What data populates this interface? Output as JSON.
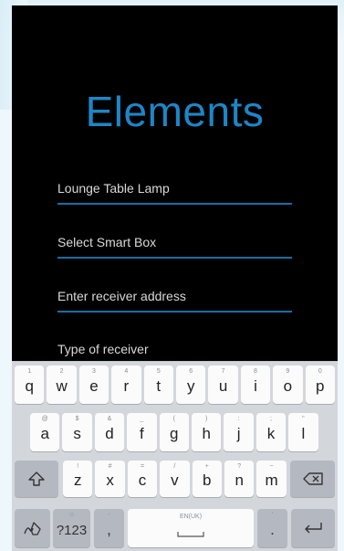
{
  "app": {
    "title": "Elements",
    "fields": [
      {
        "value": "Lounge Table Lamp",
        "placeholder": ""
      },
      {
        "value": "",
        "placeholder": "Select Smart Box"
      },
      {
        "value": "",
        "placeholder": "Enter receiver address"
      },
      {
        "value": "",
        "placeholder": "Type of receiver"
      }
    ]
  },
  "keyboard": {
    "row1": [
      {
        "label": "q",
        "hint": "1"
      },
      {
        "label": "w",
        "hint": "2"
      },
      {
        "label": "e",
        "hint": "3"
      },
      {
        "label": "r",
        "hint": "4"
      },
      {
        "label": "t",
        "hint": "5"
      },
      {
        "label": "y",
        "hint": "6"
      },
      {
        "label": "u",
        "hint": "7"
      },
      {
        "label": "i",
        "hint": "8"
      },
      {
        "label": "o",
        "hint": "9"
      },
      {
        "label": "p",
        "hint": "0"
      }
    ],
    "row2": [
      {
        "label": "a",
        "hint": "@"
      },
      {
        "label": "s",
        "hint": "$"
      },
      {
        "label": "d",
        "hint": "&"
      },
      {
        "label": "f",
        "hint": "_"
      },
      {
        "label": "g",
        "hint": "("
      },
      {
        "label": "h",
        "hint": ")"
      },
      {
        "label": "j",
        "hint": ":"
      },
      {
        "label": "k",
        "hint": ";"
      },
      {
        "label": "l",
        "hint": "\""
      }
    ],
    "row3": [
      {
        "label": "z",
        "hint": "!"
      },
      {
        "label": "x",
        "hint": "#"
      },
      {
        "label": "c",
        "hint": "="
      },
      {
        "label": "v",
        "hint": "/"
      },
      {
        "label": "b",
        "hint": "+"
      },
      {
        "label": "n",
        "hint": "?"
      },
      {
        "label": "m",
        "hint": "~"
      }
    ],
    "shift_icon": "shift-arrow-icon",
    "backspace_icon": "backspace-icon",
    "handwriting_icon": "handwriting-icon",
    "symbols_label": "?123",
    "symbols_hint": "☺",
    "comma_label": ",",
    "comma_hint": "-",
    "space_hint": "EN(UK)",
    "period_label": ".",
    "period_hint": "'",
    "enter_icon": "enter-icon"
  },
  "colors": {
    "accent": "#1d86c6",
    "underline": "#1a6da3",
    "screen_bg": "#000000",
    "keyboard_bg": "#d3d6db"
  }
}
